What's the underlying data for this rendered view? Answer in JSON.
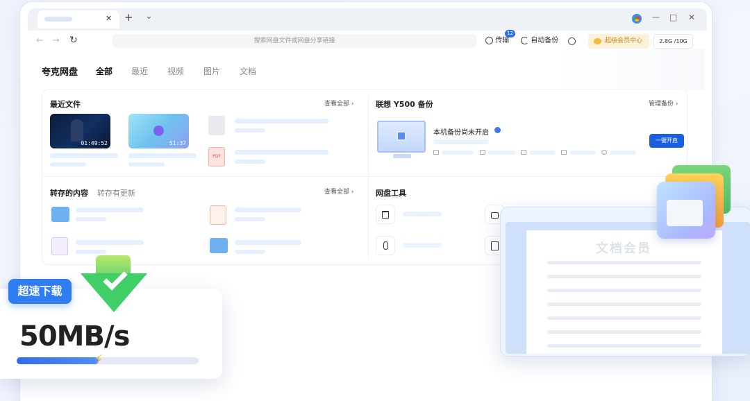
{
  "search_placeholder": "搜索网盘文件或网盘分享链接",
  "toolbar": {
    "transfer_label": "传输",
    "transfer_badge": "12",
    "backup_label": "自动备份",
    "vip_label": "超级会员中心",
    "storage": "2.8G /10G"
  },
  "tab_controls": {
    "close": "✕",
    "new_tab": "+",
    "tab_menu": "⌄"
  },
  "window_controls": {
    "minimize": "—",
    "maximize": "□",
    "close": "✕"
  },
  "nav": {
    "back": "←",
    "forward": "→",
    "refresh": "↻"
  },
  "brand": "夸克网盘",
  "categories": [
    "全部",
    "最近",
    "视频",
    "图片",
    "文档"
  ],
  "recent": {
    "title": "最近文件",
    "more": "查看全部",
    "videos": [
      {
        "duration": "01:49:52"
      },
      {
        "duration": "51:37"
      }
    ],
    "pdf_label": "PDF"
  },
  "backup": {
    "title": "联想 Y500 备份",
    "manage": "管理备份",
    "status": "本机备份尚未开启",
    "button": "一键开启"
  },
  "transfer_section": {
    "title": "转存的内容",
    "subtitle": "转存有更新",
    "more": "查看全部"
  },
  "tools": {
    "title": "网盘工具"
  },
  "speed": {
    "badge": "超速下载",
    "value": "50MB/s",
    "progress": 0.45
  },
  "doc_card": {
    "title": "文档会员"
  },
  "colors": {
    "accent": "#1a5fe0",
    "speed_badge": "#2f7df0",
    "check": "#3fcf66",
    "vip": "#c8871e"
  },
  "icons": [
    "chrome-icon",
    "transfer-icon",
    "backup-icon",
    "settings-icon",
    "vip-icon",
    "trash-icon",
    "lock-icon",
    "mic-icon",
    "pdf-convert-icon",
    "folder-icon",
    "ppt-icon",
    "book-icon",
    "windows-icon",
    "lightning-icon",
    "check-icon"
  ]
}
